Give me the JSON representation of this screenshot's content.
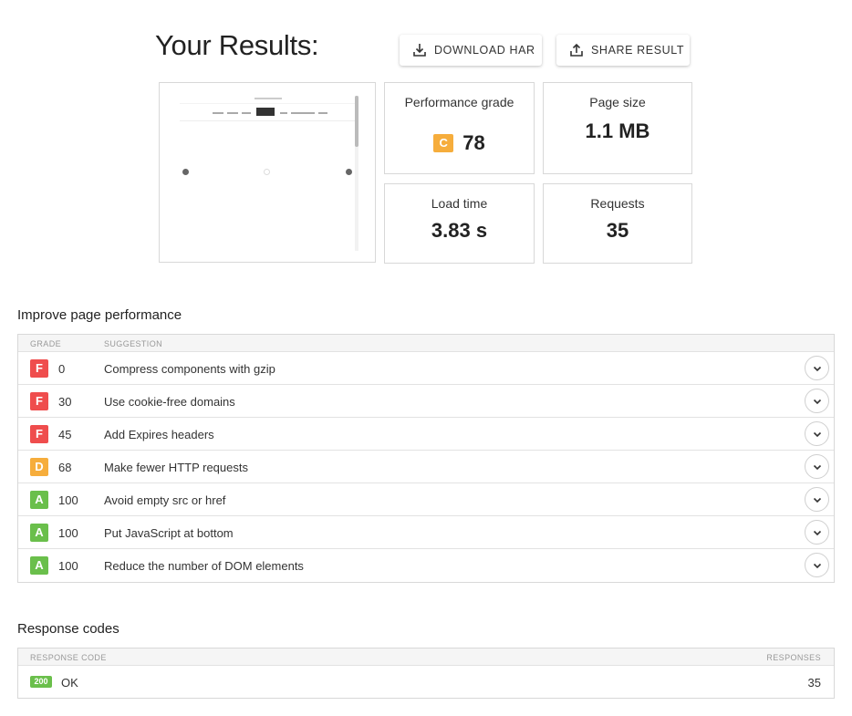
{
  "header": {
    "title": "Your Results:",
    "download_label": "DOWNLOAD HAR",
    "share_label": "SHARE RESULT"
  },
  "stats": {
    "grade_label": "Performance grade",
    "grade_letter": "C",
    "grade_score": "78",
    "grade_color": "#f6ad3c",
    "size_label": "Page size",
    "size_value": "1.1 MB",
    "load_label": "Load time",
    "load_value": "3.83 s",
    "requests_label": "Requests",
    "requests_value": "35"
  },
  "improve": {
    "title": "Improve page performance",
    "col_grade": "GRADE",
    "col_suggestion": "SUGGESTION",
    "rows": [
      {
        "grade": "F",
        "score": "0",
        "suggestion": "Compress components with gzip",
        "color": "#ef4d4d"
      },
      {
        "grade": "F",
        "score": "30",
        "suggestion": "Use cookie-free domains",
        "color": "#ef4d4d"
      },
      {
        "grade": "F",
        "score": "45",
        "suggestion": "Add Expires headers",
        "color": "#ef4d4d"
      },
      {
        "grade": "D",
        "score": "68",
        "suggestion": "Make fewer HTTP requests",
        "color": "#f6ad3c"
      },
      {
        "grade": "A",
        "score": "100",
        "suggestion": "Avoid empty src or href",
        "color": "#6abf4b"
      },
      {
        "grade": "A",
        "score": "100",
        "suggestion": "Put JavaScript at bottom",
        "color": "#6abf4b"
      },
      {
        "grade": "A",
        "score": "100",
        "suggestion": "Reduce the number of DOM elements",
        "color": "#6abf4b"
      }
    ]
  },
  "codes": {
    "title": "Response codes",
    "col_code": "RESPONSE CODE",
    "col_responses": "RESPONSES",
    "rows": [
      {
        "code": "200",
        "label": "OK",
        "count": "35"
      }
    ]
  }
}
